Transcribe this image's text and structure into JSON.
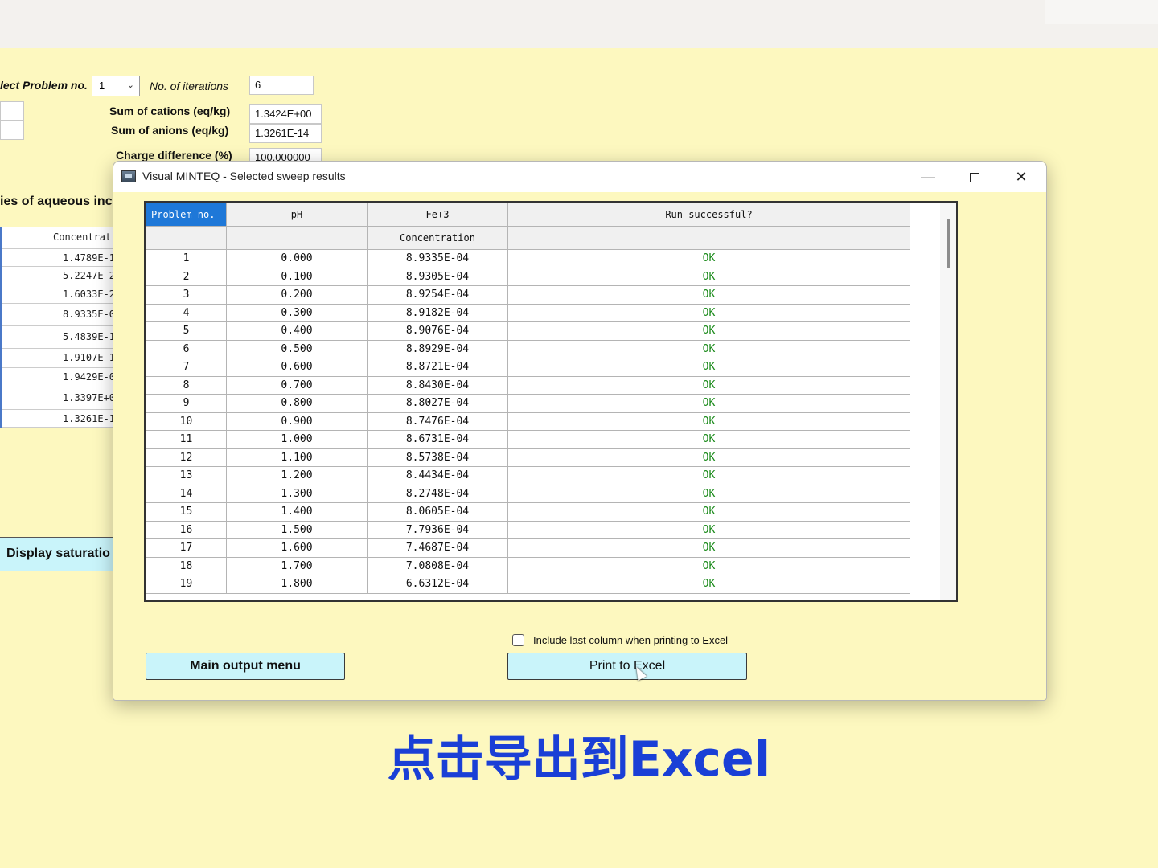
{
  "background": {
    "select_problem_label": "lect Problem no.",
    "select_problem_value": "1",
    "iterations_label": "No. of iterations",
    "iterations_value": "6",
    "sum_cations_label": "Sum of cations (eq/kg)",
    "sum_cations_value": "1.3424E+00",
    "sum_anions_label": "Sum of anions (eq/kg)",
    "sum_anions_value": "1.3261E-14",
    "charge_diff_label": "Charge difference (%)",
    "charge_diff_value": "100.000000",
    "species_heading": "ies of aqueous inc",
    "conc_header": "Concentrat",
    "conc_values": [
      "1.4789E-1",
      "5.2247E-2",
      "1.6033E-2",
      "8.9335E-0",
      "5.4839E-1",
      "1.9107E-1",
      "1.9429E-0",
      "1.3397E+0",
      "1.3261E-1"
    ],
    "display_button": "Display saturatio"
  },
  "dialog": {
    "title": "Visual MINTEQ - Selected sweep results",
    "controls": {
      "minimize": "—",
      "close": "✕"
    },
    "columns": [
      "Problem no.",
      "pH",
      "Fe+3",
      "Run successful?"
    ],
    "subheaders": [
      "",
      "",
      "Concentration",
      ""
    ],
    "rows": [
      [
        "1",
        "0.000",
        "8.9335E-04",
        "OK"
      ],
      [
        "2",
        "0.100",
        "8.9305E-04",
        "OK"
      ],
      [
        "3",
        "0.200",
        "8.9254E-04",
        "OK"
      ],
      [
        "4",
        "0.300",
        "8.9182E-04",
        "OK"
      ],
      [
        "5",
        "0.400",
        "8.9076E-04",
        "OK"
      ],
      [
        "6",
        "0.500",
        "8.8929E-04",
        "OK"
      ],
      [
        "7",
        "0.600",
        "8.8721E-04",
        "OK"
      ],
      [
        "8",
        "0.700",
        "8.8430E-04",
        "OK"
      ],
      [
        "9",
        "0.800",
        "8.8027E-04",
        "OK"
      ],
      [
        "10",
        "0.900",
        "8.7476E-04",
        "OK"
      ],
      [
        "11",
        "1.000",
        "8.6731E-04",
        "OK"
      ],
      [
        "12",
        "1.100",
        "8.5738E-04",
        "OK"
      ],
      [
        "13",
        "1.200",
        "8.4434E-04",
        "OK"
      ],
      [
        "14",
        "1.300",
        "8.2748E-04",
        "OK"
      ],
      [
        "15",
        "1.400",
        "8.0605E-04",
        "OK"
      ],
      [
        "16",
        "1.500",
        "7.7936E-04",
        "OK"
      ],
      [
        "17",
        "1.600",
        "7.4687E-04",
        "OK"
      ],
      [
        "18",
        "1.700",
        "7.0808E-04",
        "OK"
      ],
      [
        "19",
        "1.800",
        "6.6312E-04",
        "OK"
      ]
    ],
    "checkbox_label": "Include last column when printing to Excel",
    "main_output_button": "Main output menu",
    "print_excel_button": "Print to Excel"
  },
  "caption": "点击导出到Excel"
}
